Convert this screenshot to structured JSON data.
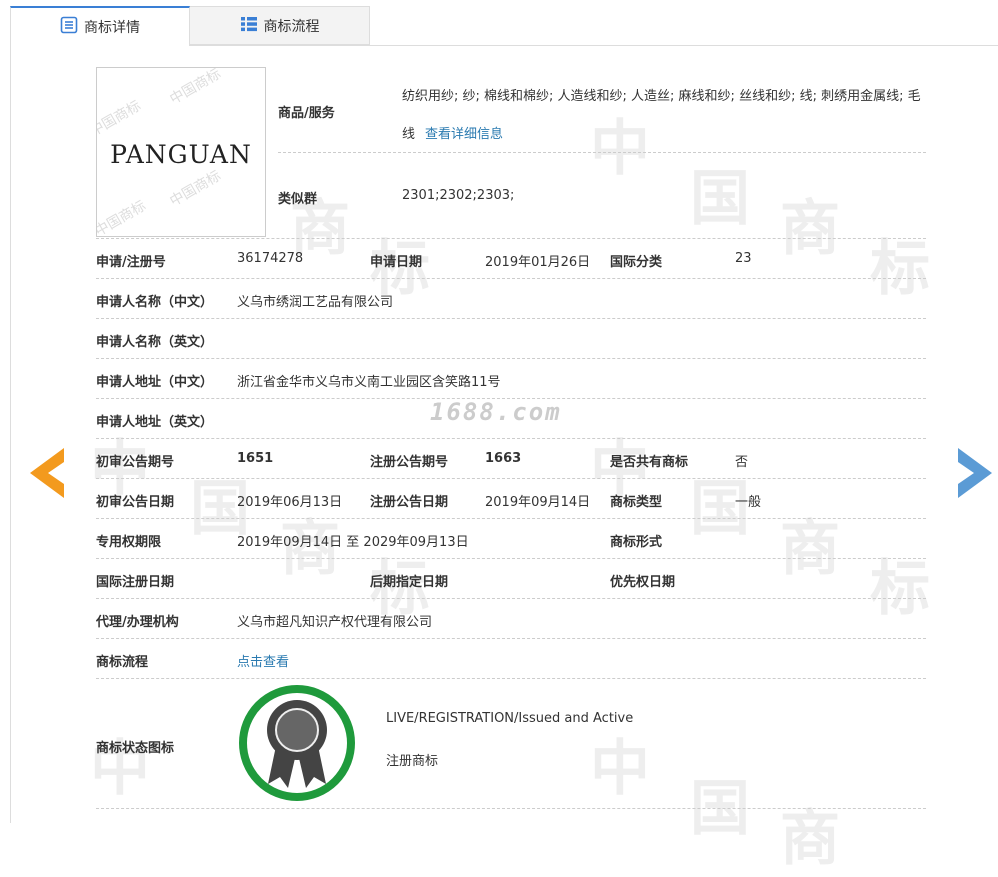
{
  "tabs": [
    {
      "label": "商标详情",
      "active": true
    },
    {
      "label": "商标流程",
      "active": false
    }
  ],
  "logo": {
    "text": "PANGUAN",
    "watermark": "中国商标"
  },
  "goods": {
    "label": "商品/服务",
    "value": "纺织用纱; 纱; 棉线和棉纱; 人造线和纱; 人造丝; 麻线和纱; 丝线和纱; 线; 刺绣用金属线; 毛线",
    "link": "查看详细信息"
  },
  "similar_group": {
    "label": "类似群",
    "value": "2301;2302;2303;"
  },
  "rows": {
    "reg_no": {
      "label": "申请/注册号",
      "value": "36174278"
    },
    "app_date": {
      "label": "申请日期",
      "value": "2019年01月26日"
    },
    "intl_class": {
      "label": "国际分类",
      "value": "23"
    },
    "applicant_cn": {
      "label": "申请人名称（中文）",
      "value": "义乌市绣润工艺品有限公司"
    },
    "applicant_en": {
      "label": "申请人名称（英文）",
      "value": ""
    },
    "address_cn": {
      "label": "申请人地址（中文）",
      "value": "浙江省金华市义乌市义南工业园区含笑路11号"
    },
    "address_en": {
      "label": "申请人地址（英文）",
      "value": ""
    },
    "prelim_issue": {
      "label": "初审公告期号",
      "value": "1651"
    },
    "reg_issue": {
      "label": "注册公告期号",
      "value": "1663"
    },
    "shared": {
      "label": "是否共有商标",
      "value": "否"
    },
    "prelim_date": {
      "label": "初审公告日期",
      "value": "2019年06月13日"
    },
    "reg_date": {
      "label": "注册公告日期",
      "value": "2019年09月14日"
    },
    "tm_type": {
      "label": "商标类型",
      "value": "一般"
    },
    "exclusive": {
      "label": "专用权期限",
      "value": "2019年09月14日 至 2029年09月13日"
    },
    "tm_form": {
      "label": "商标形式",
      "value": ""
    },
    "intl_reg_date": {
      "label": "国际注册日期",
      "value": ""
    },
    "later_date": {
      "label": "后期指定日期",
      "value": ""
    },
    "priority_date": {
      "label": "优先权日期",
      "value": ""
    },
    "agent": {
      "label": "代理/办理机构",
      "value": "义乌市超凡知识产权代理有限公司"
    },
    "process": {
      "label": "商标流程",
      "link": "点击查看"
    },
    "status": {
      "label": "商标状态图标",
      "line1": "LIVE/REGISTRATION/Issued and Active",
      "line2": "注册商标"
    }
  },
  "watermark_site": "1688.com",
  "bg_watermark": [
    "中",
    "国",
    "商",
    "标"
  ],
  "colors": {
    "accent": "#3a7fd5",
    "link": "#2a7ab0",
    "prev_arrow": "#f39a1e",
    "next_arrow": "#5b9bd5",
    "badge_ring": "#1f9a3c"
  }
}
